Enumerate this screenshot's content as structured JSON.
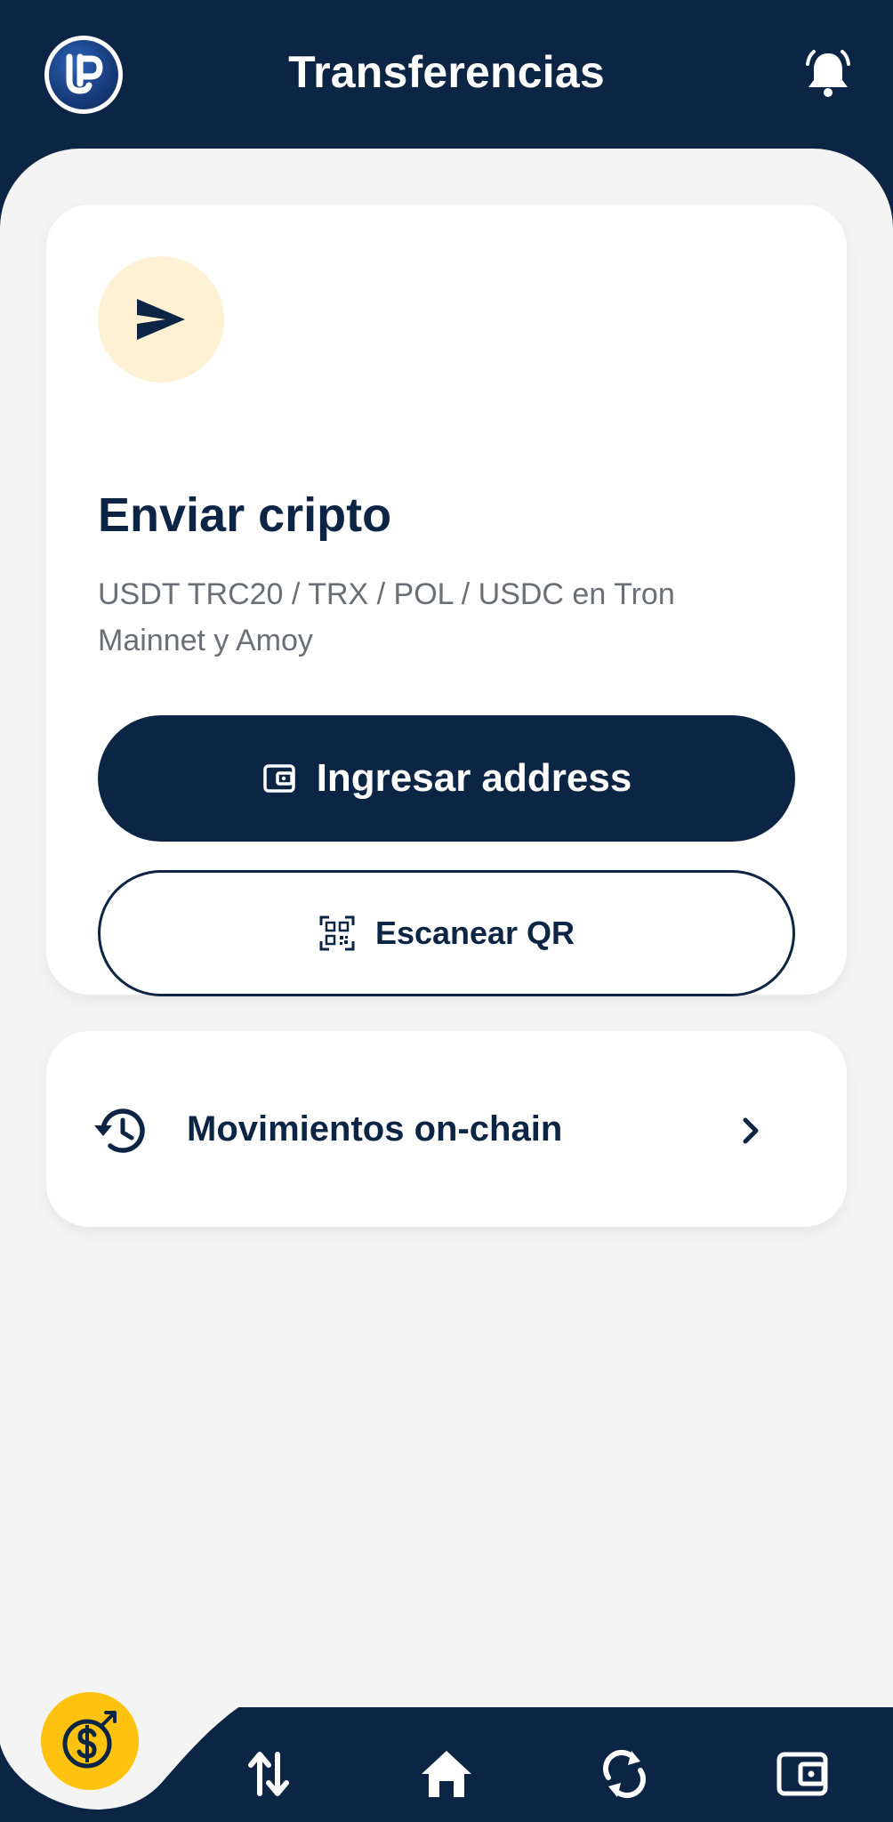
{
  "header": {
    "title": "Transferencias",
    "logo_text": "UP"
  },
  "send_card": {
    "title": "Enviar cripto",
    "subtitle": "USDT TRC20 / TRX / POL / USDC en Tron Mainnet y Amoy",
    "primary_button_label": "Ingresar address",
    "secondary_button_label": "Escanear QR"
  },
  "history": {
    "label": "Movimientos on-chain"
  },
  "nav": {
    "items": [
      "arrows-transfer-icon",
      "home-icon",
      "refresh-icon",
      "wallet-icon"
    ]
  },
  "colors": {
    "primary": "#0d2545",
    "accent": "#ffc20e",
    "badge_bg": "#fff1d4",
    "background": "#f4f4f4"
  }
}
